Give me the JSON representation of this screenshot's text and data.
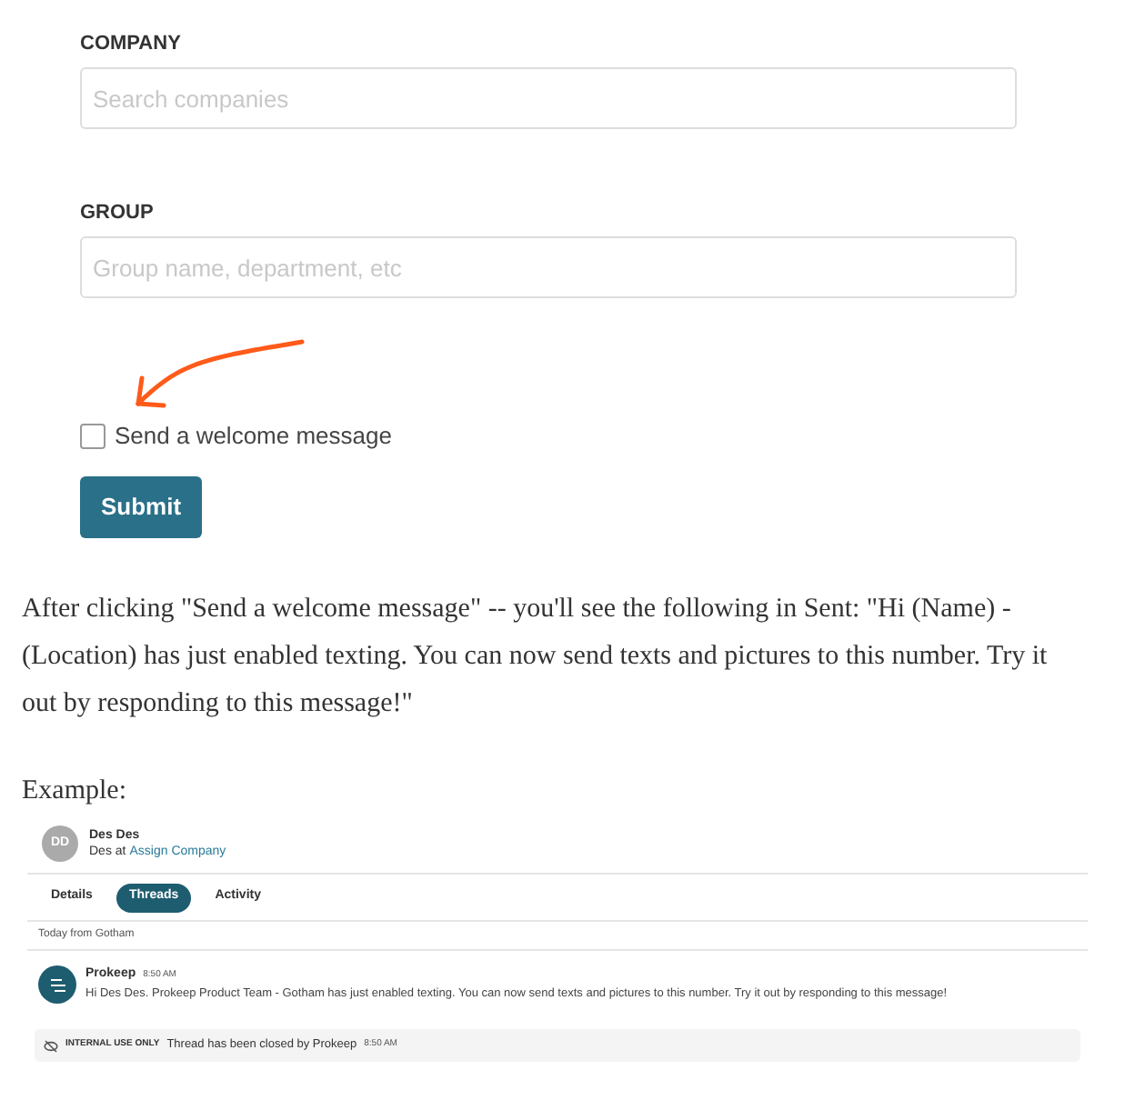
{
  "form": {
    "fields": [
      {
        "label": "COMPANY",
        "placeholder": "Search companies"
      },
      {
        "label": "GROUP",
        "placeholder": "Group name, department, etc"
      }
    ],
    "welcome_checkbox": {
      "label": "Send a welcome message",
      "checked": false
    },
    "submit": "Submit"
  },
  "paragraph": "After clicking \"Send a welcome message\" -- you'll see the following in Sent: \"Hi (Name) - (Location) has just enabled texting. You can now send texts and pictures to this number. Try it out by responding to this message!\"",
  "example_label": "Example:",
  "example": {
    "contact": {
      "initials": "DD",
      "name": "Des Des",
      "subtitle": "Des at",
      "company_link": "Assign Company"
    },
    "tabs": [
      {
        "label": "Details",
        "selected": false
      },
      {
        "label": "Threads",
        "selected": true
      },
      {
        "label": "Activity",
        "selected": false
      }
    ],
    "date_header": "Today from Gotham",
    "message": {
      "sender": "Prokeep",
      "time": "8:50 AM",
      "text": "Hi Des Des. Prokeep Product Team - Gotham has just enabled texting. You can now send texts and pictures to this number. Try it out by responding to this message!"
    },
    "note": {
      "badge": "INTERNAL USE ONLY",
      "text": "Thread has been closed by Prokeep",
      "time": "8:50 AM"
    }
  }
}
